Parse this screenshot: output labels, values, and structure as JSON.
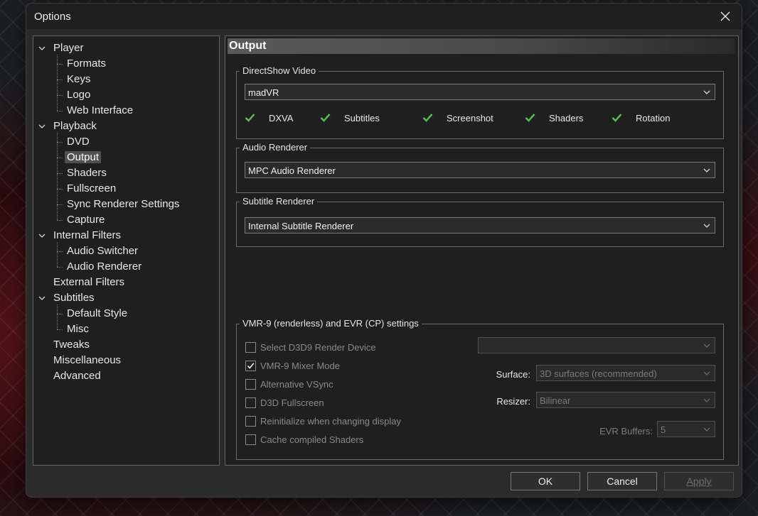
{
  "window": {
    "title": "Options"
  },
  "tree": {
    "items": [
      {
        "label": "Player",
        "level": 0,
        "expander": true
      },
      {
        "label": "Formats",
        "level": 1
      },
      {
        "label": "Keys",
        "level": 1
      },
      {
        "label": "Logo",
        "level": 1
      },
      {
        "label": "Web Interface",
        "level": 1
      },
      {
        "label": "Playback",
        "level": 0,
        "expander": true
      },
      {
        "label": "DVD",
        "level": 1
      },
      {
        "label": "Output",
        "level": 1,
        "selected": true
      },
      {
        "label": "Shaders",
        "level": 1
      },
      {
        "label": "Fullscreen",
        "level": 1
      },
      {
        "label": "Sync Renderer Settings",
        "level": 1
      },
      {
        "label": "Capture",
        "level": 1
      },
      {
        "label": "Internal Filters",
        "level": 0,
        "expander": true
      },
      {
        "label": "Audio Switcher",
        "level": 1
      },
      {
        "label": "Audio Renderer",
        "level": 1
      },
      {
        "label": "External Filters",
        "level": 0
      },
      {
        "label": "Subtitles",
        "level": 0,
        "expander": true
      },
      {
        "label": "Default Style",
        "level": 1
      },
      {
        "label": "Misc",
        "level": 1
      },
      {
        "label": "Tweaks",
        "level": 0
      },
      {
        "label": "Miscellaneous",
        "level": 0
      },
      {
        "label": "Advanced",
        "level": 0
      }
    ]
  },
  "page": {
    "header": "Output"
  },
  "directshow": {
    "legend": "DirectShow Video",
    "renderer": "madVR",
    "capabilities": [
      {
        "label": "DXVA"
      },
      {
        "label": "Subtitles"
      },
      {
        "label": "Screenshot"
      },
      {
        "label": "Shaders"
      },
      {
        "label": "Rotation"
      }
    ]
  },
  "audio": {
    "legend": "Audio Renderer",
    "renderer": "MPC Audio Renderer"
  },
  "subtitle": {
    "legend": "Subtitle Renderer",
    "renderer": "Internal Subtitle Renderer"
  },
  "vmr": {
    "legend": "VMR-9 (renderless) and EVR (CP) settings",
    "options": [
      {
        "label": "Select D3D9 Render Device",
        "checked": false
      },
      {
        "label": "VMR-9 Mixer Mode",
        "checked": true
      },
      {
        "label": "Alternative VSync",
        "checked": false
      },
      {
        "label": "D3D Fullscreen",
        "checked": false
      },
      {
        "label": "Reinitialize when changing display",
        "checked": false
      },
      {
        "label": "Cache compiled Shaders",
        "checked": false
      }
    ],
    "device": "",
    "surface_label": "Surface:",
    "surface_value": "3D surfaces (recommended)",
    "resizer_label": "Resizer:",
    "resizer_value": "Bilinear",
    "evr_buffers_label": "EVR Buffers:",
    "evr_buffers_value": "5"
  },
  "buttons": {
    "ok": "OK",
    "cancel": "Cancel",
    "apply": "Apply"
  },
  "colors": {
    "check_green": "#5cc05c",
    "window_bg": "#2b2b2b",
    "panel_bg": "#1f1f1f"
  }
}
